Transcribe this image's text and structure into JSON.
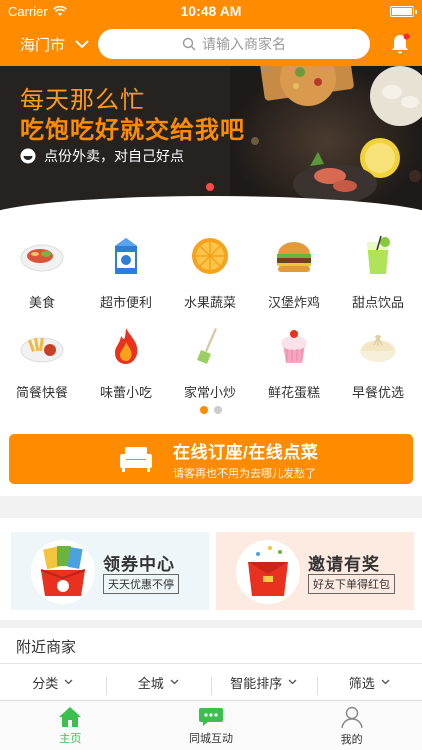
{
  "status": {
    "carrier": "Carrier",
    "time": "10:48 AM"
  },
  "header": {
    "city": "海门市",
    "search_placeholder": "请输入商家名"
  },
  "banner": {
    "title": "每天那么忙",
    "subtitle": "吃饱吃好就交给我吧",
    "tagline": "点份外卖，对自己好点"
  },
  "categories": [
    {
      "label": "美食",
      "icon": "dish-icon"
    },
    {
      "label": "超市便利",
      "icon": "milk-carton-icon"
    },
    {
      "label": "水果蔬菜",
      "icon": "orange-icon"
    },
    {
      "label": "汉堡炸鸡",
      "icon": "burger-icon"
    },
    {
      "label": "甜点饮品",
      "icon": "drink-icon"
    },
    {
      "label": "简餐快餐",
      "icon": "fastfood-icon"
    },
    {
      "label": "味蕾小吃",
      "icon": "flame-icon"
    },
    {
      "label": "家常小炒",
      "icon": "spatula-icon"
    },
    {
      "label": "鲜花蛋糕",
      "icon": "cake-icon"
    },
    {
      "label": "早餐优选",
      "icon": "bun-icon"
    }
  ],
  "pager": {
    "count": 2,
    "active": 1
  },
  "order": {
    "title": "在线订座/在线点菜",
    "subtitle": "请客再也不用为去哪儿发愁了"
  },
  "promos": [
    {
      "title": "领券中心",
      "tag": "天天优惠不停",
      "bg": "#eef6f9"
    },
    {
      "title": "邀请有奖",
      "tag": "好友下单得红包",
      "bg": "#fdebe2"
    }
  ],
  "nearby": {
    "title": "附近商家"
  },
  "filters": [
    "分类",
    "全城",
    "智能排序",
    "筛选"
  ],
  "tabs": [
    {
      "label": "主页",
      "active": true
    },
    {
      "label": "同城互动",
      "active": false
    },
    {
      "label": "我的",
      "active": false
    }
  ],
  "colors": {
    "brand": "#ff8c00",
    "tab_active": "#3bbf4f"
  }
}
